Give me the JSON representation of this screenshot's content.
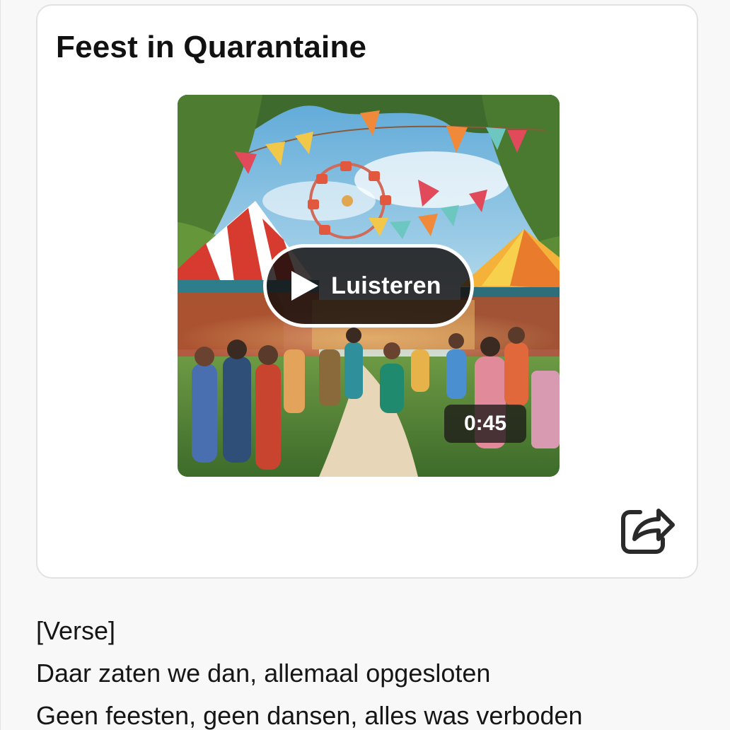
{
  "song": {
    "title": "Feest in Quarantaine",
    "play_label": "Luisteren",
    "duration": "0:45",
    "cover_icon": "festival-cover-image",
    "share_icon": "share-icon"
  },
  "lyrics": {
    "lines": [
      "[Verse]",
      "Daar zaten we dan, allemaal opgesloten",
      "Geen feesten, geen dansen, alles was verboden"
    ]
  },
  "colors": {
    "card_background": "#ffffff",
    "card_border": "#e2e2e2",
    "page_background": "#f8f8f8",
    "overlay": "#140e0c",
    "text": "#111111"
  }
}
